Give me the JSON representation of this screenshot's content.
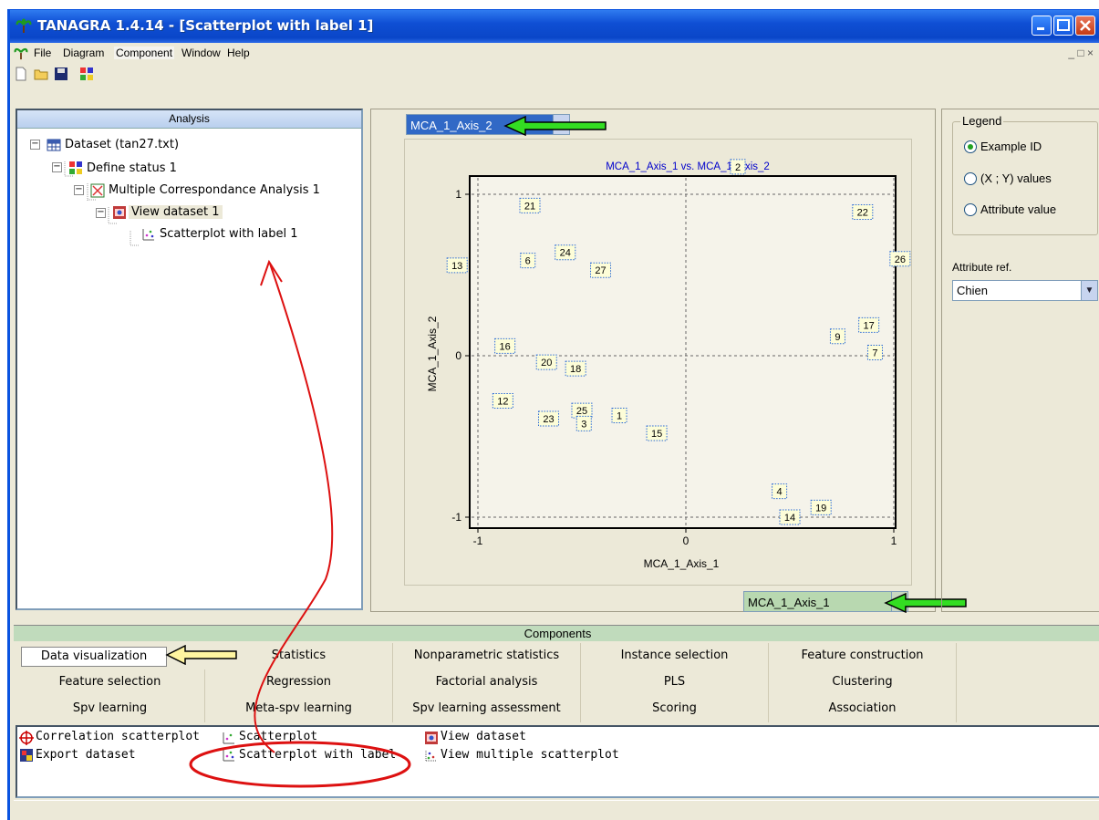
{
  "window": {
    "title": "TANAGRA 1.4.14 - [Scatterplot with label 1]"
  },
  "menu": [
    "File",
    "Diagram",
    "Component",
    "Window",
    "Help"
  ],
  "analysis": {
    "header": "Analysis",
    "tree": [
      {
        "label": "Dataset (tan27.txt)"
      },
      {
        "label": "Define status 1"
      },
      {
        "label": "Multiple Correspondance Analysis 1"
      },
      {
        "label": "View dataset 1"
      },
      {
        "label": "Scatterplot with label 1"
      }
    ]
  },
  "plot": {
    "y_combo": "MCA_1_Axis_2",
    "x_combo": "MCA_1_Axis_1"
  },
  "chart_data": {
    "type": "scatter",
    "title": "MCA_1_Axis_1 vs. MCA_1_Axis_2",
    "xlabel": "MCA_1_Axis_1",
    "ylabel": "MCA_1_Axis_2",
    "xlim": [
      -1,
      1
    ],
    "ylim": [
      -1,
      1
    ],
    "xticks": [
      "-1",
      "0",
      "1"
    ],
    "yticks": [
      "1",
      "0",
      "-1"
    ],
    "points": [
      {
        "label": "2",
        "x": 0.25,
        "y": 1.17
      },
      {
        "label": "21",
        "x": -0.75,
        "y": 0.93
      },
      {
        "label": "22",
        "x": 0.85,
        "y": 0.89
      },
      {
        "label": "24",
        "x": -0.58,
        "y": 0.64
      },
      {
        "label": "6",
        "x": -0.76,
        "y": 0.59
      },
      {
        "label": "27",
        "x": -0.41,
        "y": 0.53
      },
      {
        "label": "13",
        "x": -1.1,
        "y": 0.56
      },
      {
        "label": "26",
        "x": 1.03,
        "y": 0.6
      },
      {
        "label": "17",
        "x": 0.88,
        "y": 0.19
      },
      {
        "label": "9",
        "x": 0.73,
        "y": 0.12
      },
      {
        "label": "7",
        "x": 0.91,
        "y": 0.02
      },
      {
        "label": "16",
        "x": -0.87,
        "y": 0.06
      },
      {
        "label": "20",
        "x": -0.67,
        "y": -0.04
      },
      {
        "label": "18",
        "x": -0.53,
        "y": -0.08
      },
      {
        "label": "12",
        "x": -0.88,
        "y": -0.28
      },
      {
        "label": "25",
        "x": -0.5,
        "y": -0.34
      },
      {
        "label": "23",
        "x": -0.66,
        "y": -0.39
      },
      {
        "label": "3",
        "x": -0.49,
        "y": -0.42
      },
      {
        "label": "1",
        "x": -0.32,
        "y": -0.37
      },
      {
        "label": "15",
        "x": -0.14,
        "y": -0.48
      },
      {
        "label": "4",
        "x": 0.45,
        "y": -0.84
      },
      {
        "label": "19",
        "x": 0.65,
        "y": -0.94
      },
      {
        "label": "14",
        "x": 0.5,
        "y": -1.0
      }
    ]
  },
  "legend": {
    "title": "Legend",
    "options": [
      "Example ID",
      "(X ; Y) values",
      "Attribute value"
    ],
    "selected": "Example ID",
    "attr_label": "Attribute ref.",
    "attr_value": "Chien"
  },
  "components": {
    "header": "Components",
    "tabs_row1": [
      "Data visualization",
      "Statistics",
      "Nonparametric statistics",
      "Instance selection",
      "Feature construction"
    ],
    "tabs_row2": [
      "Feature selection",
      "Regression",
      "Factorial analysis",
      "PLS",
      "Clustering"
    ],
    "tabs_row3": [
      "Spv learning",
      "Meta-spv learning",
      "Spv learning assessment",
      "Scoring",
      "Association"
    ],
    "active_tab": "Data visualization",
    "items": [
      "Correlation scatterplot",
      "Export dataset",
      "Scatterplot",
      "Scatterplot with label",
      "View dataset",
      "View multiple scatterplot"
    ]
  },
  "colors": {
    "accent_arrow": "#33dd22",
    "annotation": "#dd1111",
    "combo_selected": "#3169c6"
  }
}
